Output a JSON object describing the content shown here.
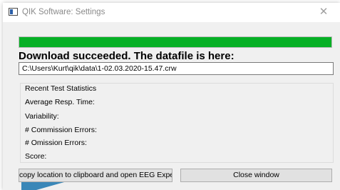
{
  "window": {
    "title": "QIK Software: Settings",
    "close_glyph": "✕"
  },
  "progress": {
    "percent": 100,
    "color": "#06b025"
  },
  "heading": "Download succeeded. The datafile is here:",
  "path": {
    "value": "C:\\Users\\Kurt\\qik\\data\\1-02.03.2020-15.47.crw"
  },
  "stats": {
    "title": "Recent Test Statistics",
    "lines": [
      "Average Resp. Time:",
      "Variability:",
      "# Commission Errors:",
      "# Omission Errors:",
      "Score:"
    ]
  },
  "buttons": {
    "copy_label": "copy location to clipboard and open EEG Expert",
    "close_label": "Close window"
  }
}
